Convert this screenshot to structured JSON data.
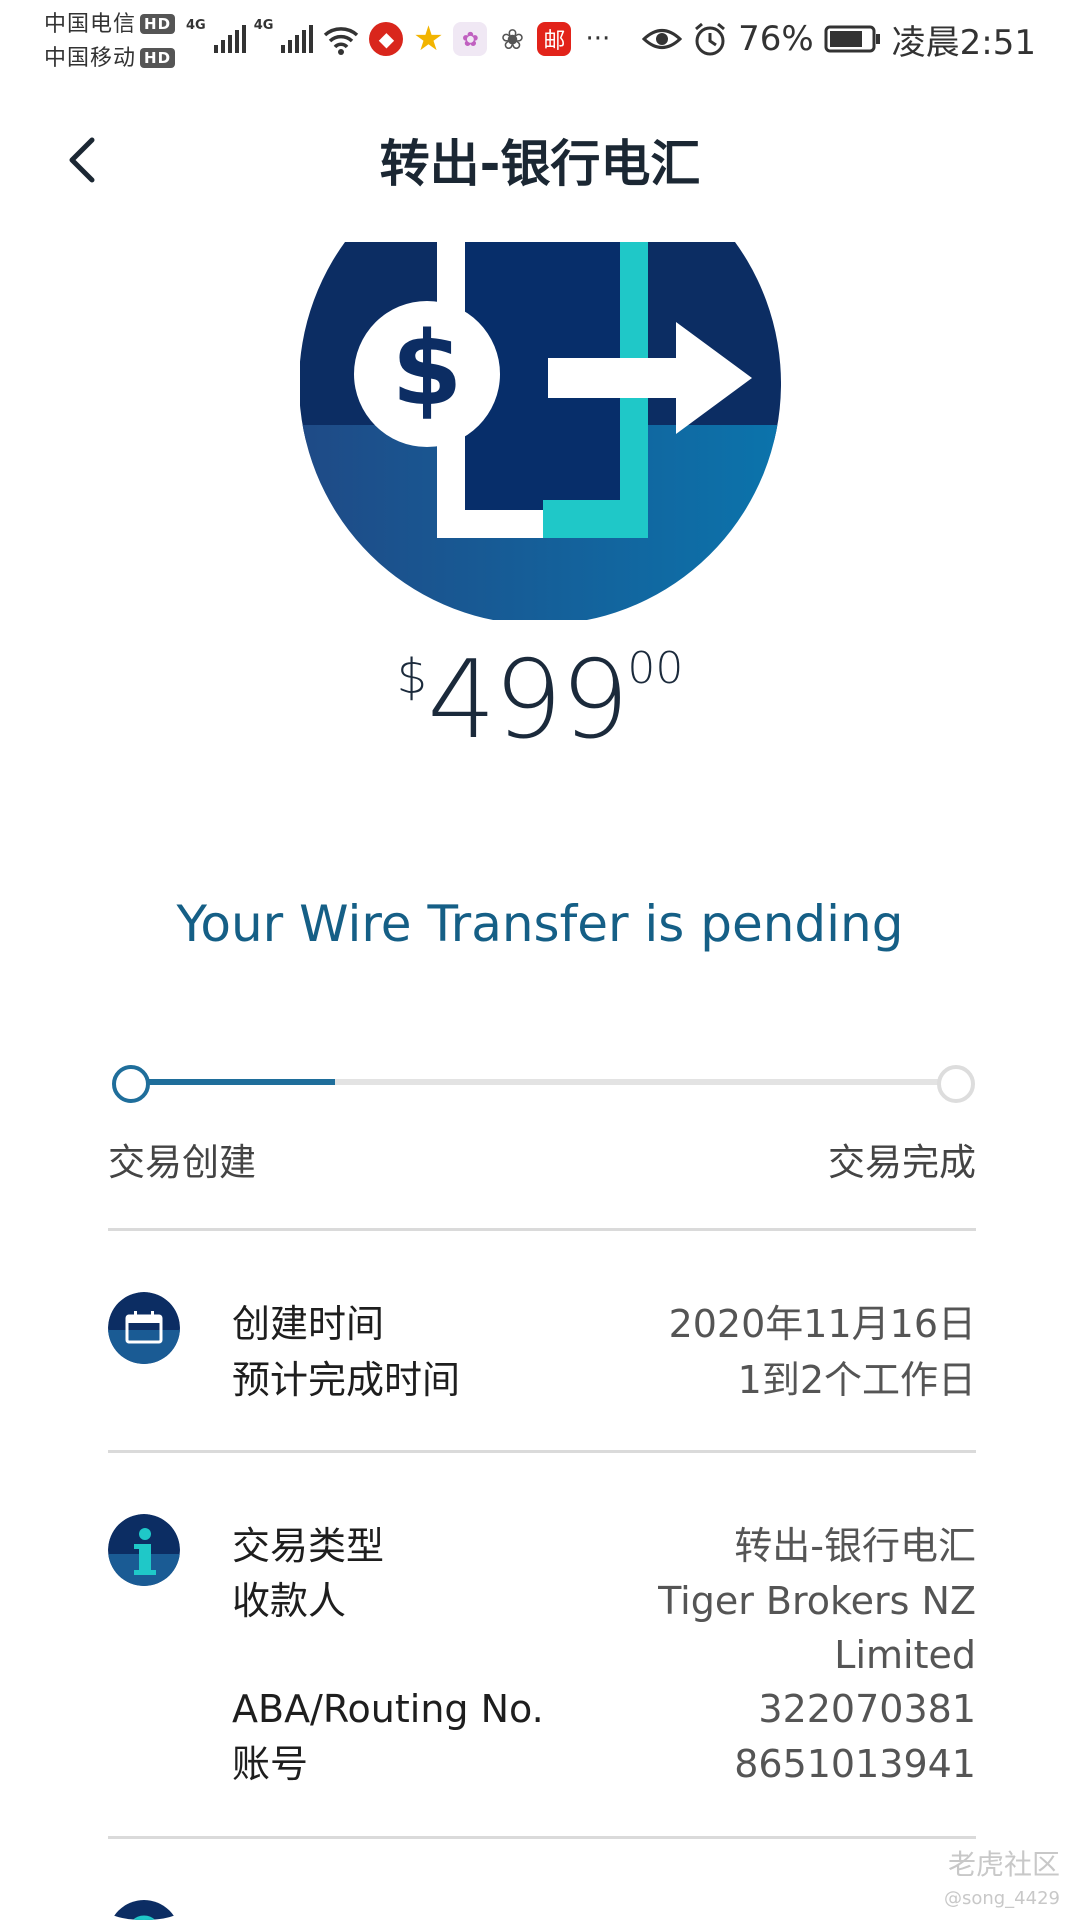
{
  "status_bar": {
    "carrier1": "中国电信",
    "carrier2": "中国移动",
    "hd": "HD",
    "net": "4G",
    "more": "···",
    "battery": "76%",
    "time": "凌晨2:51"
  },
  "header": {
    "title": "转出-银行电汇"
  },
  "amount": {
    "currency": "$",
    "integer": "499",
    "decimal": "00"
  },
  "status_message": "Your Wire Transfer is pending",
  "progress": {
    "start_label": "交易创建",
    "end_label": "交易完成",
    "fraction": 0.25
  },
  "schedule": {
    "created_label": "创建时间",
    "created_value": "2020年11月16日",
    "eta_label": "预计完成时间",
    "eta_value": "1到2个工作日"
  },
  "details": {
    "type_label": "交易类型",
    "type_value": "转出-银行电汇",
    "payee_label": "收款人",
    "payee_value_line1": "Tiger Brokers NZ",
    "payee_value_line2": "Limited",
    "aba_label": "ABA/Routing No.",
    "aba_value": "322070381",
    "account_label": "账号",
    "account_value": "8651013941"
  },
  "watermark": {
    "brand": "老虎社区",
    "user": "@song_4429"
  },
  "colors": {
    "navy": "#0c2d63",
    "teal": "#1fc8c8",
    "accent_text": "#155f86",
    "progress": "#1f6e9b"
  },
  "icons": [
    "chevron-left-icon",
    "wire-transfer-icon",
    "calendar-icon",
    "info-icon",
    "signal-icon",
    "wifi-icon",
    "eye-icon",
    "alarm-icon",
    "battery-icon"
  ]
}
